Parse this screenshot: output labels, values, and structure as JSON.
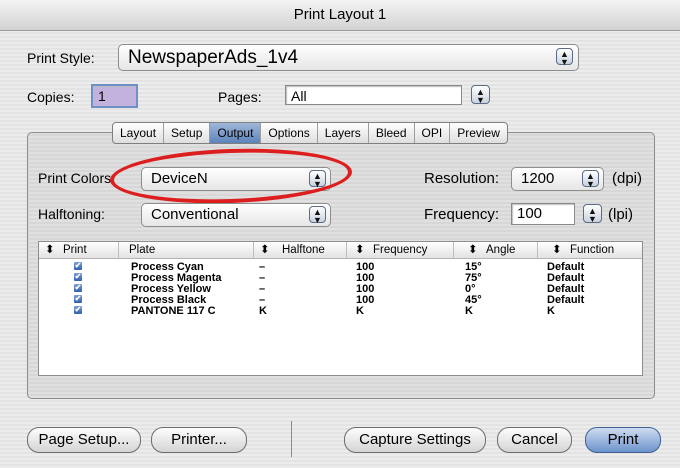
{
  "window": {
    "title": "Print Layout 1"
  },
  "print_style": {
    "label": "Print Style:",
    "value": "NewspaperAds_1v4"
  },
  "copies": {
    "label": "Copies:",
    "value": "1"
  },
  "pages": {
    "label": "Pages:",
    "value": "All"
  },
  "tabs": [
    "Layout",
    "Setup",
    "Output",
    "Options",
    "Layers",
    "Bleed",
    "OPI",
    "Preview"
  ],
  "selected_tab": "Output",
  "print_colors": {
    "label": "Print Colors",
    "value": "DeviceN"
  },
  "halftoning": {
    "label": "Halftoning:",
    "value": "Conventional"
  },
  "resolution": {
    "label": "Resolution:",
    "value": "1200",
    "unit": "(dpi)"
  },
  "frequency": {
    "label": "Frequency:",
    "value": "100",
    "unit": "(lpi)"
  },
  "table": {
    "headers": [
      "Print",
      "Plate",
      "Halftone",
      "Frequency",
      "Angle",
      "Function"
    ],
    "rows": [
      {
        "checked": true,
        "plate": "Process Cyan",
        "halftone": "–",
        "frequency": "100",
        "angle": "15°",
        "function": "Default"
      },
      {
        "checked": true,
        "plate": "Process Magenta",
        "halftone": "–",
        "frequency": "100",
        "angle": "75°",
        "function": "Default"
      },
      {
        "checked": true,
        "plate": "Process Yellow",
        "halftone": "–",
        "frequency": "100",
        "angle": "0°",
        "function": "Default"
      },
      {
        "checked": true,
        "plate": "Process Black",
        "halftone": "–",
        "frequency": "100",
        "angle": "45°",
        "function": "Default"
      },
      {
        "checked": true,
        "plate": "PANTONE 117 C",
        "halftone": "K",
        "frequency": "K",
        "angle": "K",
        "function": "K"
      }
    ]
  },
  "buttons": {
    "page_setup": "Page Setup...",
    "printer": "Printer...",
    "capture_settings": "Capture Settings",
    "cancel": "Cancel",
    "print": "Print"
  },
  "colors": {
    "highlight_oval": "#dc1e1e",
    "selected_tab": "#5d83bb",
    "default_button": "#6d93cc"
  }
}
